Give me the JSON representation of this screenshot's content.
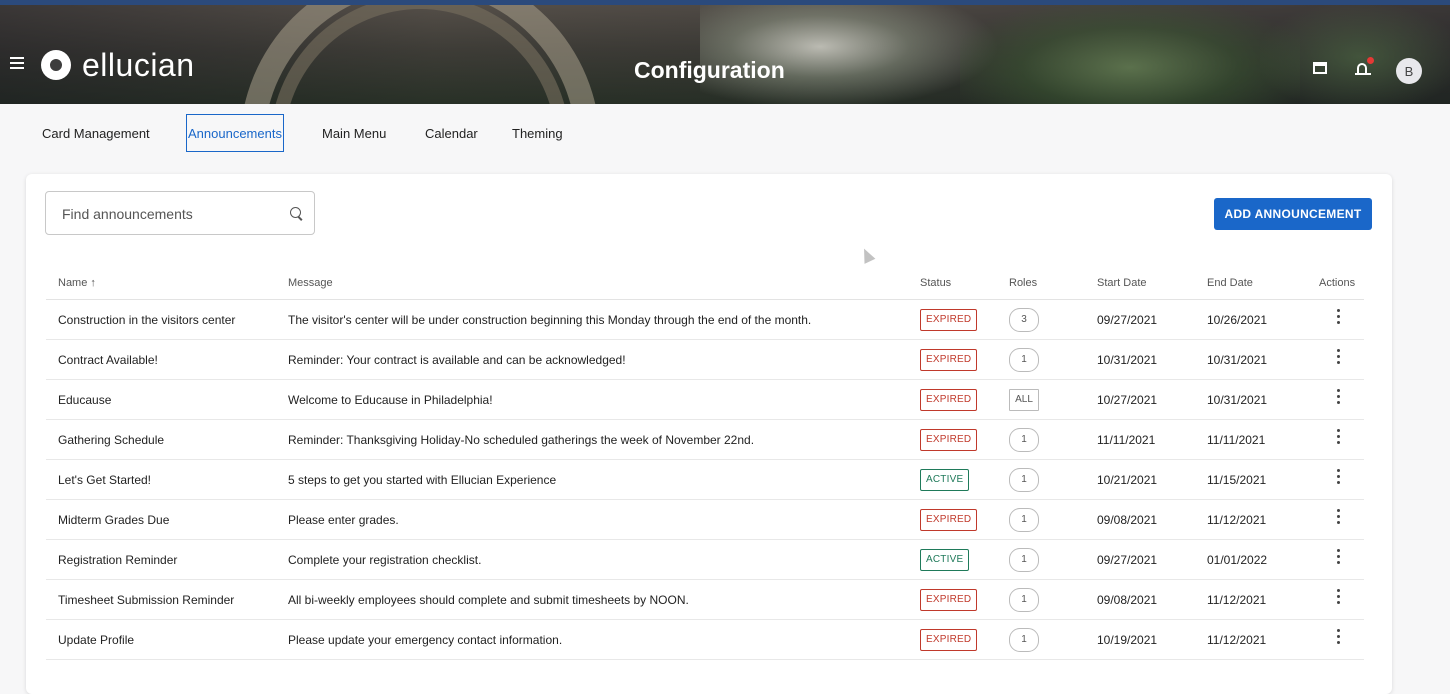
{
  "header": {
    "logo_text": "ellucian",
    "title": "Configuration",
    "avatar_initial": "B"
  },
  "tabs": [
    {
      "label": "Card Management",
      "active": false
    },
    {
      "label": "Announcements",
      "active": true
    },
    {
      "label": "Main Menu",
      "active": false
    },
    {
      "label": "Calendar",
      "active": false
    },
    {
      "label": "Theming",
      "active": false
    }
  ],
  "search": {
    "placeholder": "Find announcements"
  },
  "add_button": {
    "label": "ADD ANNOUNCEMENT"
  },
  "table": {
    "columns": {
      "name": "Name ↑",
      "message": "Message",
      "status": "Status",
      "roles": "Roles",
      "start": "Start Date",
      "end": "End Date",
      "actions": "Actions"
    },
    "rows": [
      {
        "name": "Construction in the visitors center",
        "message": "The visitor's center will be under construction beginning this Monday through the end of the month.",
        "status": "EXPIRED",
        "roles": "3",
        "start": "09/27/2021",
        "end": "10/26/2021"
      },
      {
        "name": "Contract Available!",
        "message": "Reminder: Your contract is available and can be acknowledged!",
        "status": "EXPIRED",
        "roles": "1",
        "start": "10/31/2021",
        "end": "10/31/2021"
      },
      {
        "name": "Educause",
        "message": "Welcome to Educause in Philadelphia!",
        "status": "EXPIRED",
        "roles": "ALL",
        "start": "10/27/2021",
        "end": "10/31/2021"
      },
      {
        "name": "Gathering Schedule",
        "message": "Reminder: Thanksgiving Holiday-No scheduled gatherings the week of November 22nd.",
        "status": "EXPIRED",
        "roles": "1",
        "start": "11/11/2021",
        "end": "11/11/2021"
      },
      {
        "name": "Let's Get Started!",
        "message": "5 steps to get you started with Ellucian Experience",
        "status": "ACTIVE",
        "roles": "1",
        "start": "10/21/2021",
        "end": "11/15/2021"
      },
      {
        "name": "Midterm Grades Due",
        "message": "Please enter grades.",
        "status": "EXPIRED",
        "roles": "1",
        "start": "09/08/2021",
        "end": "11/12/2021"
      },
      {
        "name": "Registration Reminder",
        "message": "Complete your registration checklist.",
        "status": "ACTIVE",
        "roles": "1",
        "start": "09/27/2021",
        "end": "01/01/2022"
      },
      {
        "name": "Timesheet Submission Reminder",
        "message": "All bi-weekly employees should complete and submit timesheets by NOON.",
        "status": "EXPIRED",
        "roles": "1",
        "start": "09/08/2021",
        "end": "11/12/2021"
      },
      {
        "name": "Update Profile",
        "message": "Please update your emergency contact information.",
        "status": "EXPIRED",
        "roles": "1",
        "start": "10/19/2021",
        "end": "11/12/2021"
      }
    ]
  }
}
